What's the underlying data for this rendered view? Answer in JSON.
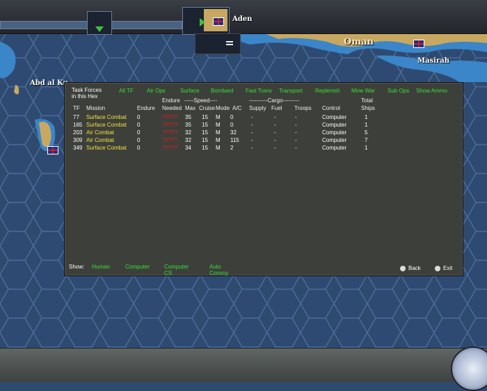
{
  "toolbar": {
    "location": "Aden"
  },
  "map": {
    "places": [
      "Oman",
      "Masirah",
      "Abd al Ku"
    ]
  },
  "panel": {
    "title_line1": "Task Forces",
    "title_line2": "in this Hex",
    "filters": [
      "All TF",
      "Air Ops",
      "Surface",
      "Bombard",
      "Fast Trans",
      "Transport",
      "Replenish",
      "Mine War",
      "Sub Ops",
      "Show Ammo"
    ],
    "headers": {
      "endure_top": "Endure",
      "speed_top": "-----Speed----",
      "cargo_top": "----------Cargo---------",
      "total_top": "Total",
      "tf": "TF",
      "mission": "Mission",
      "endure": "Endure",
      "needed": "Needed",
      "max": "Max",
      "cruise": "Cruise",
      "mode": "Mode",
      "ac": "A/C",
      "supply": "Supply",
      "fuel": "Fuel",
      "troops": "Troops",
      "control": "Control",
      "ships": "Ships"
    },
    "rows": [
      {
        "tf": "77",
        "mission": "Surface Combat",
        "endure": "0",
        "needed": "?????",
        "max": "35",
        "cruise": "15",
        "mode": "M",
        "ac": "0",
        "supply": "-",
        "fuel": "-",
        "troops": "-",
        "control": "Computer",
        "ships": "1"
      },
      {
        "tf": "165",
        "mission": "Surface Combat",
        "endure": "0",
        "needed": "?????",
        "max": "35",
        "cruise": "15",
        "mode": "M",
        "ac": "0",
        "supply": "-",
        "fuel": "-",
        "troops": "-",
        "control": "Computer",
        "ships": "1"
      },
      {
        "tf": "203",
        "mission": "Air Combat",
        "endure": "0",
        "needed": "?????",
        "max": "32",
        "cruise": "15",
        "mode": "M",
        "ac": "32",
        "supply": "-",
        "fuel": "-",
        "troops": "-",
        "control": "Computer",
        "ships": "5"
      },
      {
        "tf": "309",
        "mission": "Air Combat",
        "endure": "0",
        "needed": "?????",
        "max": "32",
        "cruise": "15",
        "mode": "M",
        "ac": "115",
        "supply": "-",
        "fuel": "-",
        "troops": "-",
        "control": "Computer",
        "ships": "7"
      },
      {
        "tf": "349",
        "mission": "Surface Combat",
        "endure": "0",
        "needed": "?????",
        "max": "34",
        "cruise": "15",
        "mode": "M",
        "ac": "2",
        "supply": "-",
        "fuel": "-",
        "troops": "-",
        "control": "Computer",
        "ships": "1"
      }
    ],
    "show_label": "Show:",
    "show_options": [
      "Human",
      "Computer",
      "Computer CS",
      "Auto Convoy"
    ],
    "back": "Back",
    "exit": "Exit"
  },
  "colors": {
    "ocean": "#2e4a6e",
    "shallow": "#3a86c8",
    "land": "#c8a860",
    "green_text": "#36e036",
    "mission_text": "#f0e040",
    "alert_red": "#e02020"
  }
}
